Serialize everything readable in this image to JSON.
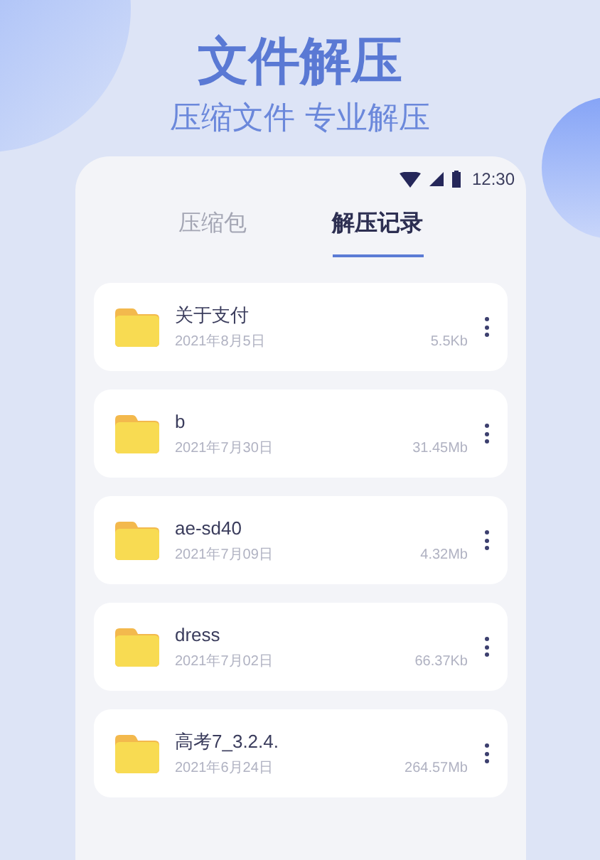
{
  "header": {
    "title": "文件解压",
    "subtitle": "压缩文件 专业解压"
  },
  "status_bar": {
    "time": "12:30"
  },
  "tabs": [
    {
      "label": "压缩包",
      "selected": false
    },
    {
      "label": "解压记录",
      "selected": true
    }
  ],
  "files": [
    {
      "name": "关于支付",
      "date": "2021年8月5日",
      "size": "5.5Kb"
    },
    {
      "name": "b",
      "date": "2021年7月30日",
      "size": "31.45Mb"
    },
    {
      "name": "ae-sd40",
      "date": "2021年7月09日",
      "size": "4.32Mb"
    },
    {
      "name": "dress",
      "date": "2021年7月02日",
      "size": "66.37Kb"
    },
    {
      "name": "高考7_3.2.4.",
      "date": "2021年6月24日",
      "size": "264.57Mb"
    }
  ]
}
